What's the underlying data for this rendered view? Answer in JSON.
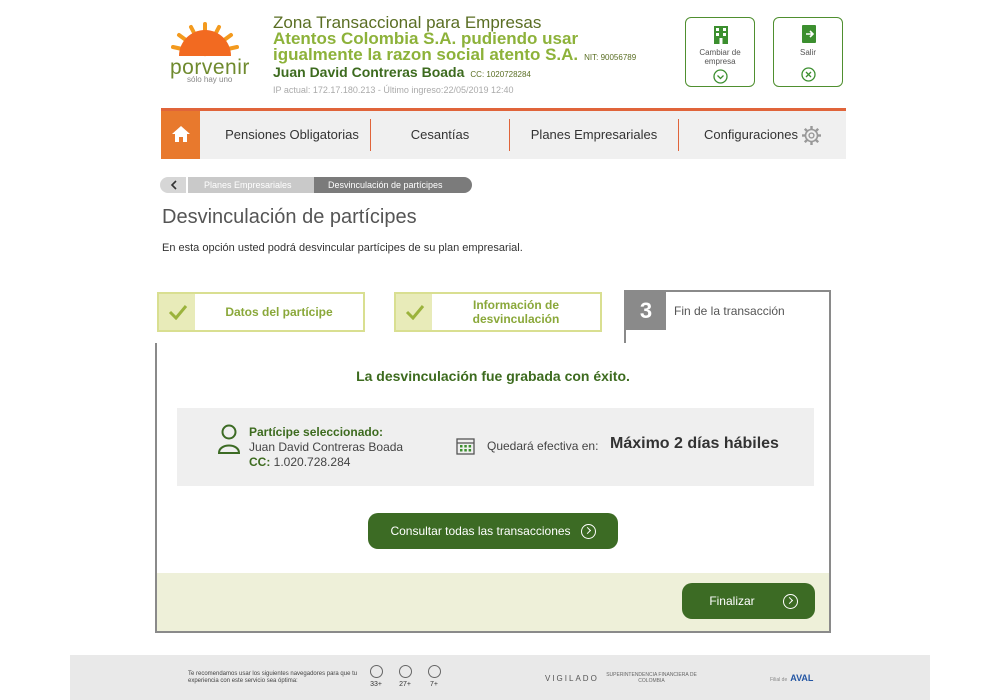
{
  "header": {
    "logo_word": "porvenir",
    "logo_tagline": "sólo hay uno",
    "title": "Zona Transaccional para Empresas",
    "company": "Atentos Colombia S.A. pudiendo usar igualmente la razon social atento S.A.",
    "nit": "NIT: 90056789",
    "user": "Juan David Contreras Boada",
    "user_cc": "CC: 1020728284",
    "ip_info": "IP actual: 172.17.180.213 - Último ingreso:22/05/2019 12:40",
    "change_company_label": "Cambiar de empresa",
    "exit_label": "Salir"
  },
  "nav": {
    "items": [
      "Pensiones Obligatorias",
      "Cesantías",
      "Planes Empresariales",
      "Configuraciones"
    ]
  },
  "breadcrumb": {
    "items": [
      "Planes Empresariales",
      "Desvinculación de partícipes"
    ]
  },
  "page": {
    "title": "Desvinculación de partícipes",
    "description": "En esta opción usted podrá desvincular partícipes de su plan empresarial."
  },
  "steps": [
    {
      "label": "Datos del partícipe",
      "status": "done"
    },
    {
      "label": "Información de desvinculación",
      "status": "done"
    },
    {
      "number": "3",
      "label": "Fin de la transacción",
      "status": "current"
    }
  ],
  "result": {
    "success_message": "La desvinculación fue grabada con éxito.",
    "participant_label": "Partícipe seleccionado:",
    "participant_name": "Juan David Contreras Boada",
    "participant_cc_label": "CC:",
    "participant_cc": "1.020.728.284",
    "effective_label": "Quedará efectiva en:",
    "effective_value": "Máximo 2 días hábiles",
    "consult_button": "Consultar todas las transacciones",
    "finish_button": "Finalizar"
  },
  "footer": {
    "recommend_text": "Te recomendamos usar los siguientes navegadores para que tu experiencia con este servicio sea óptima:",
    "browsers": [
      "33+",
      "27+",
      "7+"
    ],
    "vigilado": "VIGILADO",
    "superintendencia": "SUPERINTENDENCIA FINANCIERA DE COLOMBIA",
    "aval_prefix": "Filial de",
    "aval": "AVAL"
  },
  "colors": {
    "brand_green": "#3c6b24",
    "accent_orange": "#e0643a",
    "light_green": "#8db23a"
  }
}
